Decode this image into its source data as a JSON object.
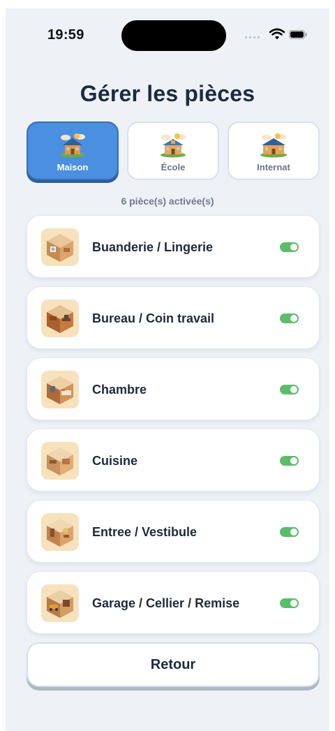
{
  "status_bar": {
    "time": "19:59",
    "icons": [
      "signal-dots-icon",
      "wifi-icon",
      "battery-icon"
    ]
  },
  "page": {
    "title": "Gérer les pièces"
  },
  "tabs": [
    {
      "label": "Maison",
      "icon": "house-icon",
      "selected": true
    },
    {
      "label": "École",
      "icon": "school-icon",
      "selected": false
    },
    {
      "label": "Internat",
      "icon": "boarding-house-icon",
      "selected": false
    }
  ],
  "summary": {
    "activated": "6 pièce(s) activée(s)"
  },
  "rooms": [
    {
      "name": "Buanderie / Lingerie",
      "icon": "laundry-room-icon",
      "enabled": true
    },
    {
      "name": "Bureau / Coin travail",
      "icon": "office-room-icon",
      "enabled": true
    },
    {
      "name": "Chambre",
      "icon": "bedroom-icon",
      "enabled": true
    },
    {
      "name": "Cuisine",
      "icon": "kitchen-icon",
      "enabled": true
    },
    {
      "name": "Entree / Vestibule",
      "icon": "entrance-icon",
      "enabled": true
    },
    {
      "name": "Garage / Cellier / Remise",
      "icon": "garage-icon",
      "enabled": true
    }
  ],
  "actions": {
    "back_label": "Retour"
  },
  "colors": {
    "accent": "#4a8fe0",
    "toggle_on": "#5bbd6a",
    "background": "#eef2f7",
    "title": "#1b2b40"
  }
}
